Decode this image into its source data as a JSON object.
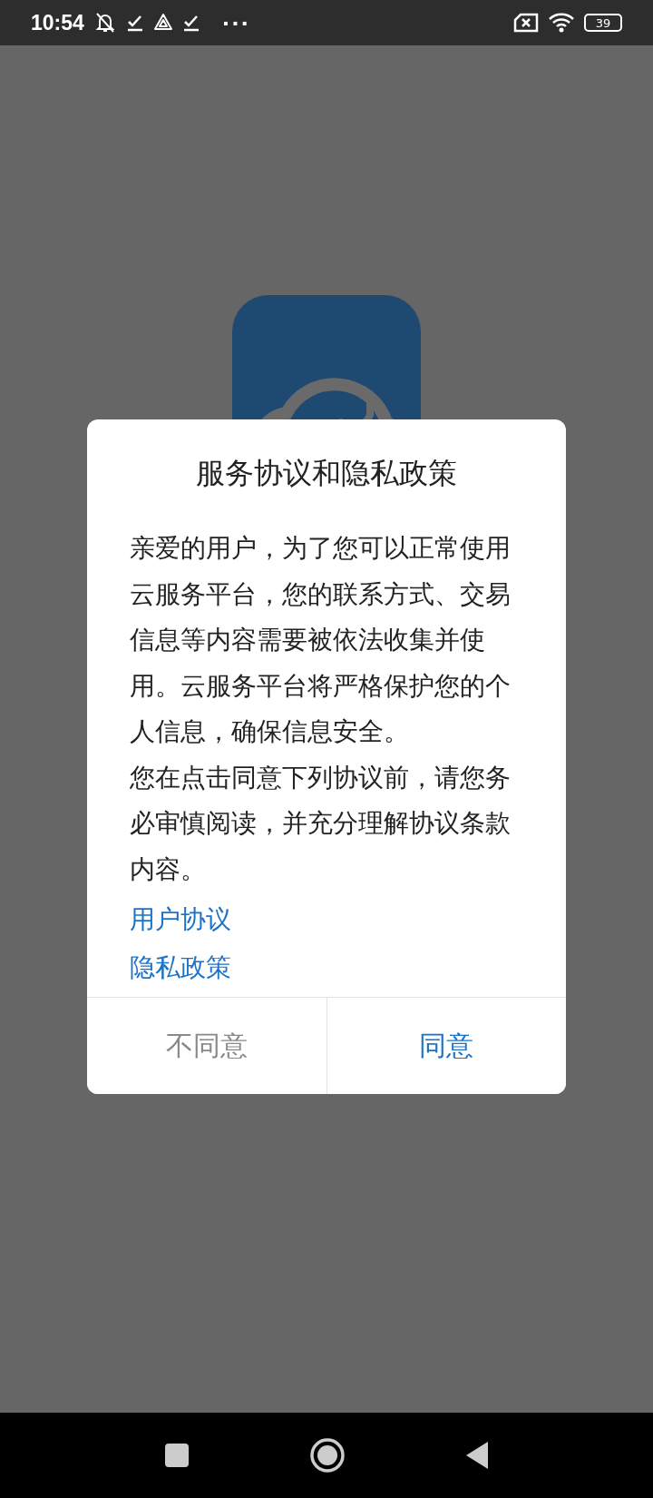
{
  "status_bar": {
    "time": "10:54",
    "more": "···",
    "battery": "39"
  },
  "dialog": {
    "title": "服务协议和隐私政策",
    "paragraphs": [
      "亲爱的用户，为了您可以正常使用云服务平台，您的联系方式、交易信息等内容需要被依法收集并使用。云服务平台将严格保护您的个人信息，确保信息安全。",
      "您在点击同意下列协议前，请您务必审慎阅读，并充分理解协议条款内容。"
    ],
    "links": [
      "用户协议",
      "隐私政策"
    ],
    "buttons": [
      {
        "label": "不同意",
        "kind": "decline"
      },
      {
        "label": "同意",
        "kind": "accept"
      }
    ]
  }
}
